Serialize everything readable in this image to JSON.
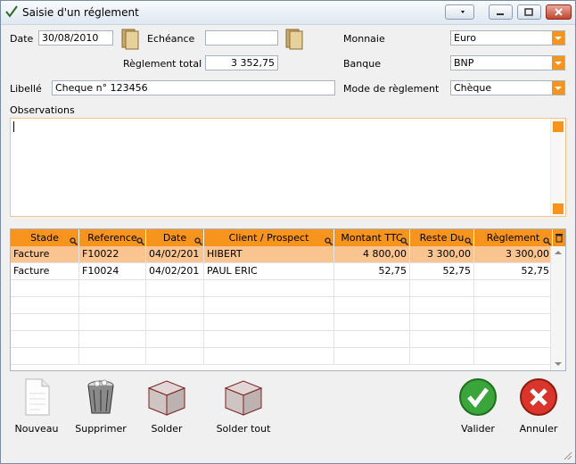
{
  "window": {
    "title": "Saisie d'un réglement"
  },
  "form": {
    "date_label": "Date",
    "date_value": "30/08/2010",
    "echeance_label": "Echéance",
    "echeance_value": "",
    "reglement_total_label": "Règlement total",
    "reglement_total_value": "3 352,75",
    "monnaie_label": "Monnaie",
    "monnaie_value": "Euro",
    "banque_label": "Banque",
    "banque_value": "BNP",
    "libelle_label": "Libellé",
    "libelle_value": "Cheque n° 123456",
    "mode_label": "Mode de règlement",
    "mode_value": "Chèque",
    "observations_label": "Observations",
    "observations_value": ""
  },
  "table": {
    "columns": [
      "Stade",
      "Reference",
      "Date",
      "Client / Prospect",
      "Montant TTC",
      "Reste Du",
      "Règlement"
    ],
    "rows": [
      [
        "Facture",
        "F10022",
        "04/02/201",
        "HIBERT",
        "4 800,00",
        "3 300,00",
        "3 300,00"
      ],
      [
        "Facture",
        "F10024",
        "04/02/201",
        "PAUL ERIC",
        "52,75",
        "52,75",
        "52,75"
      ]
    ]
  },
  "buttons": {
    "nouveau": "Nouveau",
    "supprimer": "Supprimer",
    "solder": "Solder",
    "solder_tout": "Solder tout",
    "valider": "Valider",
    "annuler": "Annuler"
  },
  "colors": {
    "accent": "#f7941d",
    "selected_row": "#f9c48f",
    "valider": "#3aa53a",
    "annuler": "#d9352a"
  }
}
